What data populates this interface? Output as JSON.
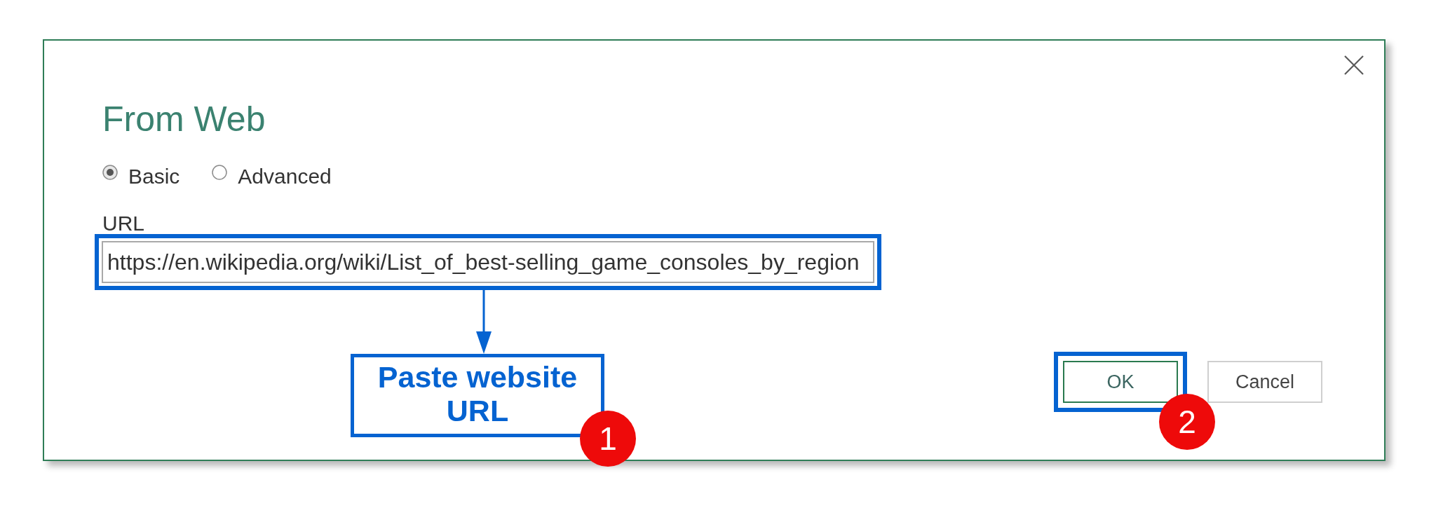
{
  "dialog": {
    "title": "From Web"
  },
  "modes": [
    {
      "label": "Basic",
      "selected": true
    },
    {
      "label": "Advanced",
      "selected": false
    }
  ],
  "url_field": {
    "label": "URL",
    "value": "https://en.wikipedia.org/wiki/List_of_best-selling_game_consoles_by_region",
    "highlighted": true
  },
  "callout": {
    "text": "Paste website URL",
    "step": "1"
  },
  "buttons": [
    {
      "label": "OK",
      "kind": "confirm",
      "highlighted": true,
      "step": "2"
    },
    {
      "label": "Cancel",
      "kind": "dismiss",
      "highlighted": false
    }
  ]
}
